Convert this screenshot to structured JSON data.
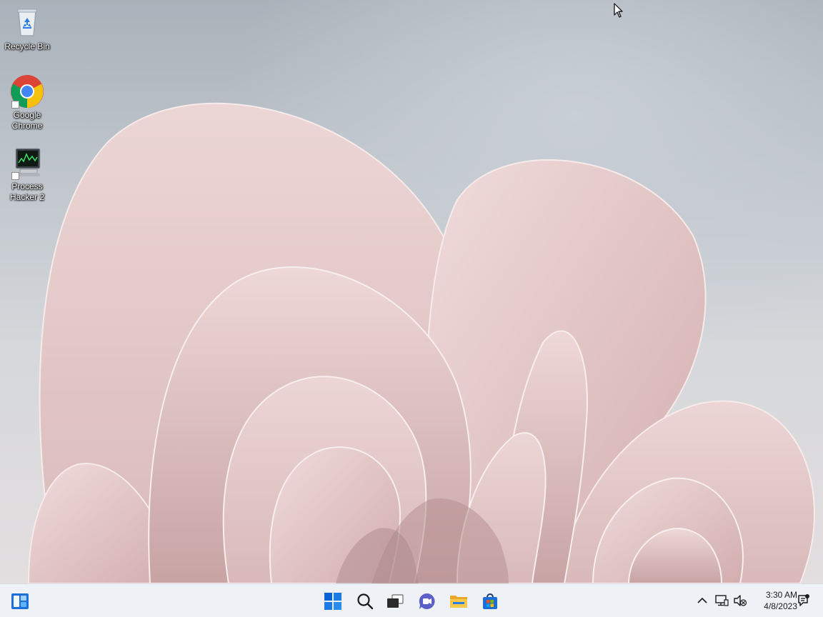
{
  "desktop": {
    "icons": [
      {
        "label": "Recycle Bin",
        "icon": "recycle-bin-icon"
      },
      {
        "label": "Google Chrome",
        "icon": "chrome-icon"
      },
      {
        "label": "Process Hacker 2",
        "icon": "process-hacker-icon"
      }
    ]
  },
  "taskbar": {
    "left": {
      "icon": "widgets-icon"
    },
    "center": [
      {
        "icon": "start-icon"
      },
      {
        "icon": "search-icon"
      },
      {
        "icon": "task-view-icon"
      },
      {
        "icon": "chat-icon"
      },
      {
        "icon": "file-explorer-icon"
      },
      {
        "icon": "store-icon"
      }
    ],
    "tray": {
      "chevron_icon": "chevron-up-icon",
      "network_icon": "network-icon",
      "volume_icon": "volume-muted-icon",
      "notification_icon": "notification-icon",
      "time": "3:30 AM",
      "date": "4/8/2023"
    }
  },
  "colors": {
    "taskbar_bg": "#eef1f5",
    "start_blue": "#0a64d8",
    "petal": "#e3c8c8"
  }
}
